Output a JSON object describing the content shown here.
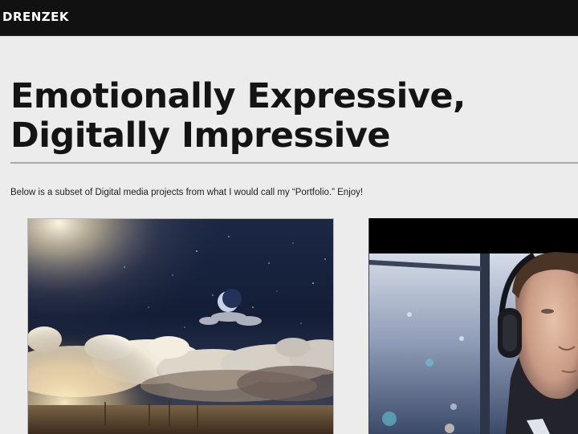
{
  "nav": {
    "brand": "DRENZEK"
  },
  "hero": {
    "title_line1": "Emotionally Expressive,",
    "title_line2": "Digitally Impressive"
  },
  "intro": {
    "text": "Below is a subset of Digital media projects from what I would call my “Portfolio.” Enjoy!"
  },
  "portfolio": {
    "items": [
      {
        "image": "moon-over-clouds-night-sky"
      },
      {
        "image": "young-man-with-headphones-by-rainy-window"
      }
    ]
  },
  "colors": {
    "nav_background": "#111111",
    "page_background": "#ececec",
    "headline_text": "#141414",
    "divider": "#a9a9a9"
  }
}
